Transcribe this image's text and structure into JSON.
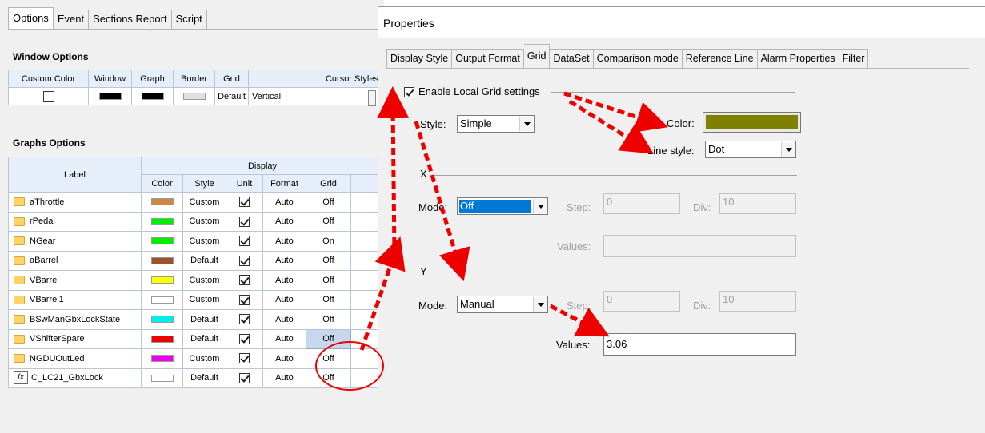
{
  "left": {
    "tabs": [
      "Options",
      "Event",
      "Sections Report",
      "Script"
    ],
    "window_options": {
      "title": "Window Options",
      "headers": [
        "Custom Color",
        "Window",
        "Graph",
        "Border",
        "Grid",
        "Cursor Styles"
      ],
      "row": {
        "grid": "Default",
        "cursor": "Vertical"
      },
      "colors": {
        "window": "#000000",
        "graph": "#000000",
        "border": "#e0e0e0"
      }
    },
    "graphs_options": {
      "title": "Graphs Options",
      "label_header": "Label",
      "display_header": "Display",
      "sub_headers": [
        "Color",
        "Style",
        "Unit",
        "Format",
        "Grid"
      ],
      "rows": [
        {
          "label": "aThrottle",
          "color": "#cc8844",
          "style": "Custom",
          "format": "Auto",
          "grid": "Off",
          "icon": "folder-icon"
        },
        {
          "label": "rPedal",
          "color": "#00ee00",
          "style": "Custom",
          "format": "Auto",
          "grid": "Off",
          "icon": "folder-icon"
        },
        {
          "label": "NGear",
          "color": "#00ee00",
          "style": "Custom",
          "format": "Auto",
          "grid": "On",
          "icon": "folder-icon"
        },
        {
          "label": "aBarrel",
          "color": "#a0522d",
          "style": "Default",
          "format": "Auto",
          "grid": "Off",
          "icon": "folder-icon"
        },
        {
          "label": "VBarrel",
          "color": "#ffff00",
          "style": "Custom",
          "format": "Auto",
          "grid": "Off",
          "icon": "folder-icon"
        },
        {
          "label": "VBarrel1",
          "color": "#ffffff",
          "style": "Custom",
          "format": "Auto",
          "grid": "Off",
          "icon": "folder-icon"
        },
        {
          "label": "BSwManGbxLockState",
          "color": "#00eeee",
          "style": "Default",
          "format": "Auto",
          "grid": "Off",
          "icon": "folder-icon"
        },
        {
          "label": "VShifterSpare",
          "color": "#ee0000",
          "style": "Default",
          "format": "Auto",
          "grid": "Off",
          "icon": "folder-icon",
          "selected": true
        },
        {
          "label": "NGDUOutLed",
          "color": "#ee00ee",
          "style": "Custom",
          "format": "Auto",
          "grid": "Off",
          "icon": "folder-icon"
        },
        {
          "label": "C_LC21_GbxLock",
          "color": "#ffffff",
          "style": "Default",
          "format": "Auto",
          "grid": "Off",
          "icon": "fx-icon"
        }
      ]
    }
  },
  "properties": {
    "title": "Properties",
    "tabs": [
      "Display Style",
      "Output Format",
      "Grid",
      "DataSet",
      "Comparison mode",
      "Reference Line",
      "Alarm Properties",
      "Filter"
    ],
    "active_tab": "Grid",
    "enable_local": "Enable Local Grid settings",
    "style_label": "Style:",
    "style_value": "Simple",
    "color_label": "Color:",
    "grid_color": "#808000",
    "line_style_label": "Line style:",
    "line_style_value": "Dot",
    "x": {
      "label": "X",
      "mode_label": "Mode:",
      "mode_value": "Off",
      "step_label": "Step:",
      "step_value": "0",
      "div_label": "Div:",
      "div_value": "10",
      "values_label": "Values:",
      "values_value": ""
    },
    "y": {
      "label": "Y",
      "mode_label": "Mode:",
      "mode_value": "Manual",
      "step_label": "Step:",
      "step_value": "0",
      "div_label": "Div:",
      "div_value": "10",
      "values_label": "Values:",
      "values_value": "3.06"
    }
  },
  "annotation_color": "#ee0000"
}
